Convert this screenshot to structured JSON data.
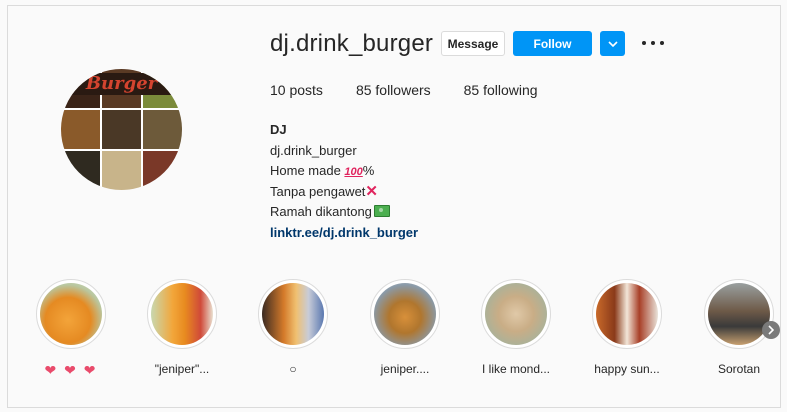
{
  "profile": {
    "username": "dj.drink_burger",
    "avatar_banner": "Burger",
    "message_label": "Message",
    "follow_label": "Follow",
    "stats": {
      "posts": "10 posts",
      "followers": "85 followers",
      "following": "85 following"
    },
    "bio": {
      "name": "DJ",
      "category": "dj.drink_burger",
      "line1_text": "Home made ",
      "line1_emoji": "100",
      "line1_suffix": "%",
      "line2_text": "Tanpa pengawet",
      "line2_emoji": "✕",
      "line3_text": "Ramah dikantong",
      "link": "linktr.ee/dj.drink_burger"
    }
  },
  "highlights": [
    {
      "label": "❤ ❤ ❤",
      "icon": "heart"
    },
    {
      "label": "\"jeniper\"...",
      "icon": ""
    },
    {
      "label": "○",
      "icon": ""
    },
    {
      "label": "jeniper....",
      "icon": ""
    },
    {
      "label": "I like mond...",
      "icon": ""
    },
    {
      "label": "happy sun...",
      "icon": ""
    },
    {
      "label": "Sorotan",
      "icon": ""
    }
  ],
  "colors": {
    "accent": "#0095f6",
    "link": "#00376b",
    "background": "#fafafa"
  },
  "icons": {
    "dropdown": "chevron-down-icon",
    "more": "more-options-icon",
    "next": "chevron-right-icon"
  }
}
